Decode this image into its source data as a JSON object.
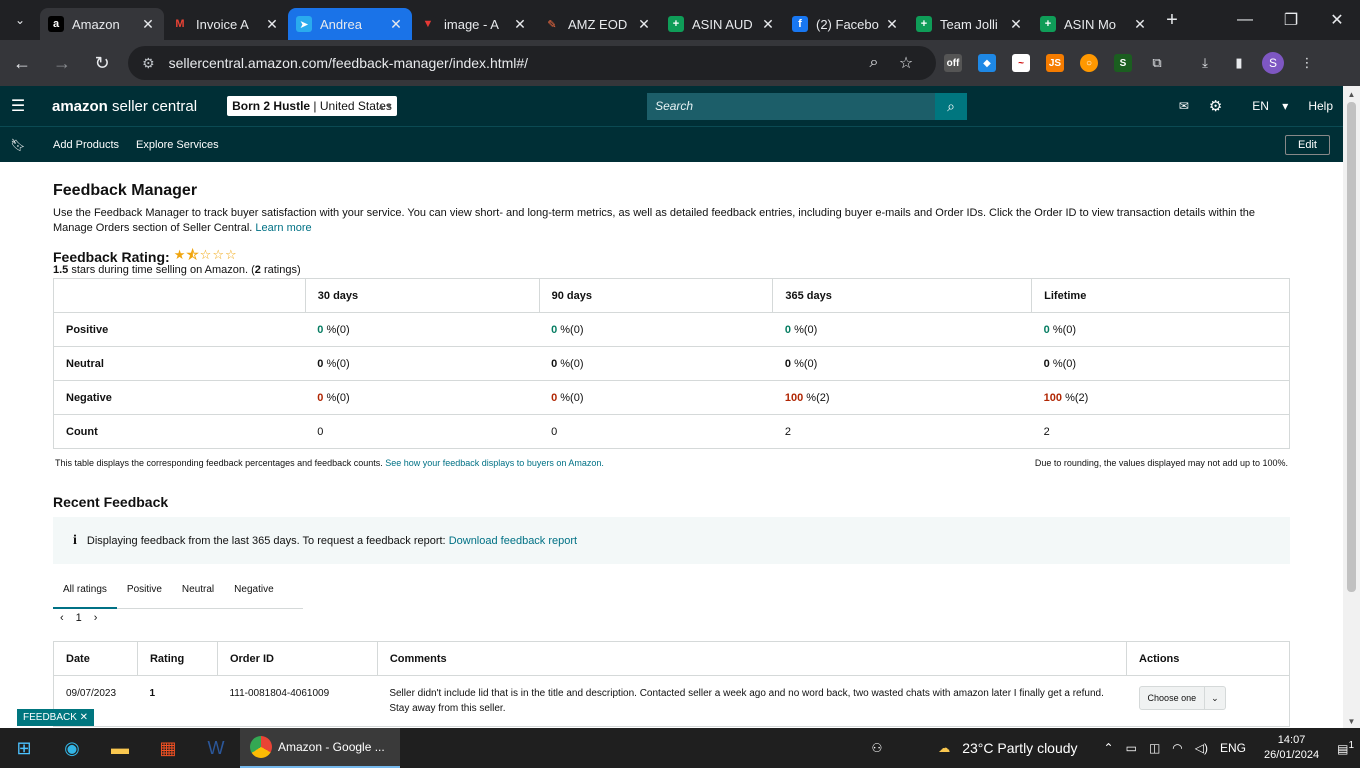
{
  "browser": {
    "tabs": [
      {
        "title": "Amazon",
        "fav": "a",
        "fav_color": "#ffffff",
        "fav_bg": "#000000",
        "active": true
      },
      {
        "title": "Invoice A",
        "fav": "M",
        "fav_color": "#ea4335",
        "fav_bg": "#202124"
      },
      {
        "title": "Andrea",
        "fav": "➤",
        "fav_color": "#ffffff",
        "fav_bg": "#2aabee",
        "highlight": true
      },
      {
        "title": "image - A",
        "fav": "▼",
        "fav_color": "#e53935",
        "fav_bg": "#202124"
      },
      {
        "title": "AMZ EOD",
        "fav": "✎",
        "fav_color": "#ff7043",
        "fav_bg": "#202124"
      },
      {
        "title": "ASIN AUD",
        "fav": "+",
        "fav_color": "#ffffff",
        "fav_bg": "#0f9d58"
      },
      {
        "title": "(2) Facebo",
        "fav": "f",
        "fav_color": "#ffffff",
        "fav_bg": "#1877f2"
      },
      {
        "title": "Team Jolli",
        "fav": "+",
        "fav_color": "#ffffff",
        "fav_bg": "#0f9d58"
      },
      {
        "title": "ASIN Mo",
        "fav": "+",
        "fav_color": "#ffffff",
        "fav_bg": "#0f9d58"
      }
    ],
    "url": "sellercentral.amazon.com/feedback-manager/index.html#/",
    "profile_initial": "S"
  },
  "header": {
    "logo_main": "amazon",
    "logo_sub": "seller central",
    "store": "Born 2 Hustle",
    "region": "United States",
    "search_placeholder": "Search",
    "lang": "EN",
    "help": "Help"
  },
  "subnav": {
    "items": [
      "Add Products",
      "Explore Services"
    ],
    "edit": "Edit"
  },
  "page": {
    "title": "Feedback Manager",
    "description": "Use the Feedback Manager to track buyer satisfaction with your service. You can view short- and long-term metrics, as well as detailed feedback entries, including buyer e-mails and Order IDs. Click the Order ID to view transaction details within the Manage Orders section of Seller Central.",
    "learn_more": "Learn more",
    "rating_label": "Feedback Rating:",
    "rating_stars": 1.5,
    "rating_value": "1.5",
    "rating_text": "stars during time selling on Amazon. (",
    "rating_count": "2",
    "rating_count_suffix": "ratings)",
    "metrics": {
      "columns": [
        "30 days",
        "90 days",
        "365 days",
        "Lifetime"
      ],
      "rows": [
        {
          "label": "Positive",
          "kind": "pos",
          "cells": [
            [
              "0",
              " %(0)"
            ],
            [
              "0",
              " %(0)"
            ],
            [
              "0",
              " %(0)"
            ],
            [
              "0",
              " %(0)"
            ]
          ]
        },
        {
          "label": "Neutral",
          "kind": "neu",
          "cells": [
            [
              "0",
              " %(0)"
            ],
            [
              "0",
              " %(0)"
            ],
            [
              "0",
              " %(0)"
            ],
            [
              "0",
              " %(0)"
            ]
          ]
        },
        {
          "label": "Negative",
          "kind": "neg",
          "cells": [
            [
              "0",
              " %(0)"
            ],
            [
              "0",
              " %(0)"
            ],
            [
              "100",
              " %(2)"
            ],
            [
              "100",
              " %(2)"
            ]
          ]
        },
        {
          "label": "Count",
          "kind": "count",
          "cells": [
            [
              "0",
              ""
            ],
            [
              "0",
              ""
            ],
            [
              "2",
              ""
            ],
            [
              "2",
              ""
            ]
          ]
        }
      ]
    },
    "note_left": "This table displays the corresponding feedback percentages and feedback counts.",
    "note_left_link": "See how your feedback displays to buyers on Amazon.",
    "note_right": "Due to rounding, the values displayed may not add up to 100%.",
    "recent_title": "Recent Feedback",
    "info_text": "Displaying feedback from the last 365 days. To request a feedback report:",
    "info_link": "Download feedback report",
    "filter_tabs": [
      "All ratings",
      "Positive",
      "Neutral",
      "Negative"
    ],
    "page_number": "1",
    "feedback_columns": [
      "Date",
      "Rating",
      "Order ID",
      "Comments",
      "Actions"
    ],
    "feedback_rows": [
      {
        "date": "09/07/2023",
        "rating": "1",
        "order_id": "111-0081804-4061009",
        "comment": "Seller didn't include lid that is in the title and description. Contacted seller a week ago and no word back, two wasted chats with amazon later I finally get a refund. Stay away from this seller.",
        "action": "Choose one"
      }
    ],
    "feedback_tag": "FEEDBACK"
  },
  "taskbar": {
    "app": "Amazon - Google ...",
    "weather": "23°C  Partly cloudy",
    "lang": "ENG",
    "time": "14:07",
    "date": "26/01/2024",
    "notif": "1"
  },
  "colors": {
    "brand": "#002f36",
    "link": "#007185",
    "positive": "#067d62",
    "negative": "#b12704",
    "star": "#f0a50e"
  }
}
